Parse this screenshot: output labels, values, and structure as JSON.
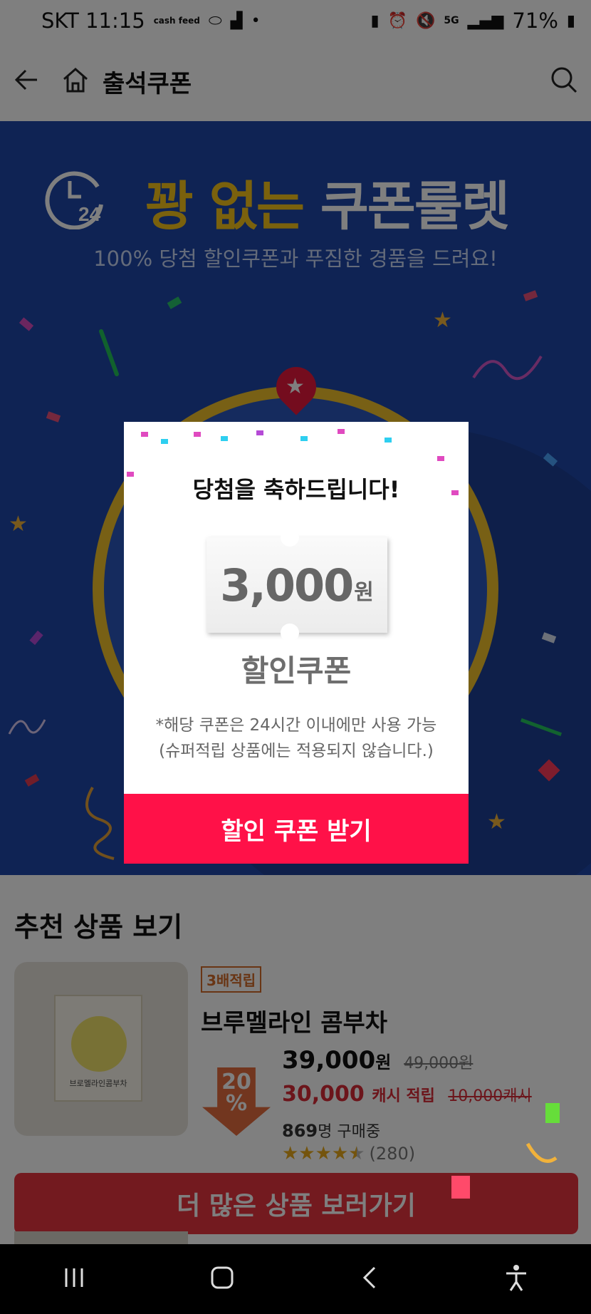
{
  "status_bar": {
    "carrier_time": "SKT 11:15",
    "cashfeed": "cash feed",
    "network": "5G",
    "battery": "71%"
  },
  "header": {
    "title": "출석쿠폰"
  },
  "banner": {
    "clock_number": "24",
    "headline_gold": "꽝 없는",
    "headline_white": "쿠폰룰렛",
    "subline": "100% 당첨 할인쿠폰과 푸짐한 경품을 드려요!"
  },
  "modal": {
    "congrats": "당첨을 축하드립니다!",
    "amount": "3,000",
    "unit": "원",
    "coupon_name": "할인쿠폰",
    "note_line1": "*해당 쿠폰은 24시간 이내에만 사용 가능",
    "note_line2": "(슈퍼적립 상품에는 적용되지 않습니다.)",
    "button_label": "할인 쿠폰 받기"
  },
  "recommend": {
    "title": "추천 상품 보기",
    "product": {
      "badge": "3배적립",
      "name": "브루멜라인 콤부차",
      "box_label": "브로멜라인콤부차",
      "discount_number": "20",
      "discount_symbol": "%",
      "price": "39,000",
      "price_unit": "원",
      "original_price": "49,000원",
      "cash_price": "30,000",
      "cash_label": "캐시 적립",
      "cash_original": "10,000캐시",
      "buyers_count": "869",
      "buyers_label": "명 구매중",
      "rating": 4.5,
      "review_count": "(280)"
    },
    "more_button": "더 많은 상품 보러가기"
  },
  "colors": {
    "banner_blue": "#1f47a8",
    "gold": "#f4c21a",
    "coupon_button": "#ff1148",
    "more_button": "#e6343f"
  }
}
